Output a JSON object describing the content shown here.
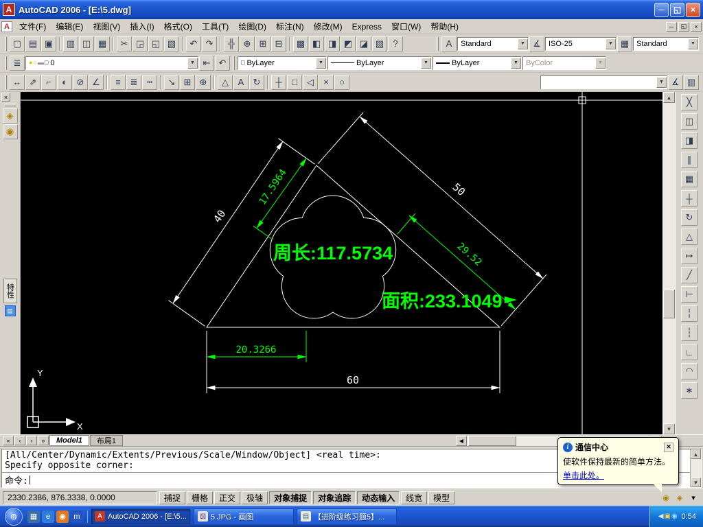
{
  "colors": {
    "annotation_green": "#00ff00",
    "entity_white": "#ffffff",
    "canvas_black": "#000000",
    "titlebar_blue": "#1c55cd"
  },
  "titlebar": {
    "title": "AutoCAD 2006 - [E:\\5.dwg]",
    "minimize": "─",
    "restore": "◱",
    "close": "×"
  },
  "menubar": {
    "items": [
      "文件(F)",
      "编辑(E)",
      "视图(V)",
      "插入(I)",
      "格式(O)",
      "工具(T)",
      "绘图(D)",
      "标注(N)",
      "修改(M)",
      "Express",
      "窗口(W)",
      "帮助(H)"
    ]
  },
  "toolbar_standard": {
    "icons": [
      {
        "name": "qnew-icon",
        "glyph": "▢"
      },
      {
        "name": "open-icon",
        "glyph": "▤"
      },
      {
        "name": "save-icon",
        "glyph": "▣"
      },
      {
        "sep": true
      },
      {
        "name": "plot-icon",
        "glyph": "▥"
      },
      {
        "name": "plot-preview-icon",
        "glyph": "◫"
      },
      {
        "name": "publish-icon",
        "glyph": "▦"
      },
      {
        "sep": true
      },
      {
        "name": "cut-icon",
        "glyph": "✂"
      },
      {
        "name": "copy-icon",
        "glyph": "◲"
      },
      {
        "name": "paste-icon",
        "glyph": "◱"
      },
      {
        "name": "match-properties-icon",
        "glyph": "▧"
      },
      {
        "sep": true
      },
      {
        "name": "undo-icon",
        "glyph": "↶"
      },
      {
        "name": "redo-icon",
        "glyph": "↷"
      },
      {
        "sep": true
      },
      {
        "name": "pan-icon",
        "glyph": "╬"
      },
      {
        "name": "zoom-realtime-icon",
        "glyph": "⊕"
      },
      {
        "name": "zoom-window-icon",
        "glyph": "⊞"
      },
      {
        "name": "zoom-previous-icon",
        "glyph": "⊟"
      },
      {
        "sep": true
      },
      {
        "name": "properties-icon",
        "glyph": "▩"
      },
      {
        "name": "designcenter-icon",
        "glyph": "◧"
      },
      {
        "name": "tool-palettes-icon",
        "glyph": "◨"
      },
      {
        "name": "sheet-set-manager-icon",
        "glyph": "◩"
      },
      {
        "name": "markup-set-manager-icon",
        "glyph": "◪"
      },
      {
        "name": "quick-calc-icon",
        "glyph": "▨"
      },
      {
        "name": "help-icon",
        "glyph": "?"
      }
    ]
  },
  "toolbar_styles": {
    "text_style": "Standard",
    "dim_style": "ISO-25",
    "table_style": "Standard"
  },
  "toolbar_layers": {
    "manager_icons": [
      {
        "name": "layer-properties-manager-icon",
        "glyph": "≣"
      }
    ],
    "state_icons": [
      {
        "name": "layer-on-bulb-icon",
        "glyph": "●",
        "color": "#e8c400"
      },
      {
        "name": "layer-thaw-sun-icon",
        "glyph": "○",
        "color": "#e8a000"
      },
      {
        "name": "layer-unlock-icon",
        "glyph": "▬",
        "color": "#8a8a8a"
      },
      {
        "name": "layer-color-swatch-icon",
        "glyph": "□",
        "color": "#000000"
      }
    ],
    "layer_name": "0",
    "after_icons": [
      {
        "name": "make-object-layer-current-icon",
        "glyph": "⇤"
      },
      {
        "name": "layer-previous-icon",
        "glyph": "↶"
      }
    ],
    "color": "ByLayer",
    "linetype": "ByLayer",
    "lineweight": "ByLayer",
    "plot_style": "ByColor"
  },
  "toolbar_dimension": {
    "icons": [
      {
        "name": "linear-dimension-icon",
        "glyph": "↔"
      },
      {
        "name": "aligned-dimension-icon",
        "glyph": "⇗"
      },
      {
        "name": "ordinate-dimension-icon",
        "glyph": "⌐"
      },
      {
        "name": "radius-dimension-icon",
        "glyph": "◐"
      },
      {
        "name": "diameter-dimension-icon",
        "glyph": "⊘"
      },
      {
        "name": "angular-dimension-icon",
        "glyph": "∠"
      },
      {
        "sep": true
      },
      {
        "name": "quick-dimension-icon",
        "glyph": "≡"
      },
      {
        "name": "baseline-dimension-icon",
        "glyph": "≣"
      },
      {
        "name": "continue-dimension-icon",
        "glyph": "┅"
      },
      {
        "sep": true
      },
      {
        "name": "quick-leader-icon",
        "glyph": "↘"
      },
      {
        "name": "tolerance-icon",
        "glyph": "⊞"
      },
      {
        "name": "center-mark-icon",
        "glyph": "⊕"
      },
      {
        "sep": true
      },
      {
        "name": "dimension-edit-icon",
        "glyph": "△"
      },
      {
        "name": "dimension-text-edit-icon",
        "glyph": "A"
      },
      {
        "name": "dimension-update-icon",
        "glyph": "↻"
      },
      {
        "sep": true
      },
      {
        "name": "snap-from-icon",
        "glyph": "┼"
      },
      {
        "name": "snap-endpoint-icon",
        "glyph": "□"
      },
      {
        "name": "snap-midpoint-icon",
        "glyph": "◁"
      },
      {
        "name": "snap-intersection-icon",
        "glyph": "×"
      },
      {
        "name": "snap-center-icon",
        "glyph": "○"
      }
    ],
    "style_value": "",
    "extra_icons": [
      {
        "name": "dimension-style-icon",
        "glyph": "∡"
      },
      {
        "name": "layer-translator-icon",
        "glyph": "▥"
      }
    ]
  },
  "left_panel": {
    "properties_tab": "特性",
    "icons": [
      {
        "name": "inquiry-distance-icon",
        "glyph": "◈",
        "color": "#b08000"
      },
      {
        "name": "inquiry-area-icon",
        "glyph": "◉",
        "color": "#b08000"
      }
    ]
  },
  "modify_toolbar": {
    "icons": [
      {
        "name": "erase-icon",
        "glyph": "╳"
      },
      {
        "name": "copy-object-icon",
        "glyph": "◫"
      },
      {
        "name": "mirror-icon",
        "glyph": "◨"
      },
      {
        "name": "offset-icon",
        "glyph": "∥"
      },
      {
        "name": "array-icon",
        "glyph": "▦"
      },
      {
        "name": "move-icon",
        "glyph": "┼"
      },
      {
        "name": "rotate-icon",
        "glyph": "↻"
      },
      {
        "name": "scale-icon",
        "glyph": "△"
      },
      {
        "name": "stretch-icon",
        "glyph": "↦"
      },
      {
        "name": "trim-icon",
        "glyph": "╱"
      },
      {
        "name": "extend-icon",
        "glyph": "⊢"
      },
      {
        "name": "break-at-point-icon",
        "glyph": "╎"
      },
      {
        "name": "break-icon",
        "glyph": "┆"
      },
      {
        "name": "chamfer-icon",
        "glyph": "∟"
      },
      {
        "name": "fillet-icon",
        "glyph": "◠"
      },
      {
        "name": "explode-icon",
        "glyph": "∗"
      }
    ]
  },
  "drawing": {
    "dim40": "40",
    "dim50": "50",
    "dim60": "60",
    "dim17": "17.5964",
    "dim29": "29.52",
    "dim20": "20.3266",
    "perimeter": "周长:117.5734",
    "area": "面积:233.1049",
    "ucs_x": "X",
    "ucs_y": "Y"
  },
  "sheet_tabs": {
    "nav": [
      "«",
      "‹",
      "›",
      "»"
    ],
    "model": "Model1",
    "layout1": "布局1"
  },
  "command": {
    "history": [
      "[All/Center/Dynamic/Extents/Previous/Scale/Window/Object] <real time>:",
      "Specify opposite corner:"
    ],
    "prompt": "命令:"
  },
  "statusbar": {
    "coordinates": "2330.2386, 876.3338, 0.0000",
    "toggles": [
      {
        "name": "toggle-snap",
        "label": "捕捉"
      },
      {
        "name": "toggle-grid",
        "label": "栅格"
      },
      {
        "name": "toggle-ortho",
        "label": "正交"
      },
      {
        "name": "toggle-polar",
        "label": "极轴"
      },
      {
        "name": "toggle-osnap",
        "label": "对象捕捉",
        "pressed": true
      },
      {
        "name": "toggle-otrack",
        "label": "对象追踪",
        "pressed": true
      },
      {
        "name": "toggle-dyn",
        "label": "动态输入",
        "pressed": true
      },
      {
        "name": "toggle-lwt",
        "label": "线宽"
      },
      {
        "name": "toggle-model",
        "label": "模型"
      }
    ]
  },
  "balloon": {
    "title": "通信中心",
    "body": "使软件保持最新的简单方法。",
    "link": "单击此处。"
  },
  "taskbar": {
    "quick_launch": [
      {
        "name": "quick-launch-show-desktop-icon",
        "glyph": "▦",
        "bg": "#3a6ea5"
      },
      {
        "name": "quick-launch-ie-icon",
        "glyph": "e",
        "bg": "#2f7ce0"
      },
      {
        "name": "quick-launch-media-player-icon",
        "glyph": "◉",
        "bg": "#e07a1f"
      },
      {
        "name": "quick-launch-msn-icon",
        "glyph": "m",
        "bg": "#2456c0"
      }
    ],
    "tasks": [
      {
        "label": "AutoCAD 2006 - [E:\\5...",
        "icon": "A",
        "icon_style": "background:#c03a2b;color:#fff"
      },
      {
        "label": "5.JPG - 画图",
        "icon": "▨",
        "icon_style": "background:#e8e4da;color:#5a4a9a"
      },
      {
        "label": "【进阶级练习题5】...",
        "icon": "▤",
        "icon_style": "background:#f0ead8;color:#3a6ea5"
      }
    ],
    "tray_icons": [
      {
        "name": "tray-collapse-icon",
        "glyph": "◀",
        "color": "#dce9ff"
      },
      {
        "name": "tray-security-icon",
        "glyph": "▣",
        "color": "#ffd24a"
      },
      {
        "name": "tray-volume-icon",
        "glyph": "◉",
        "color": "#9fe0ff"
      }
    ],
    "time": "0:54"
  }
}
